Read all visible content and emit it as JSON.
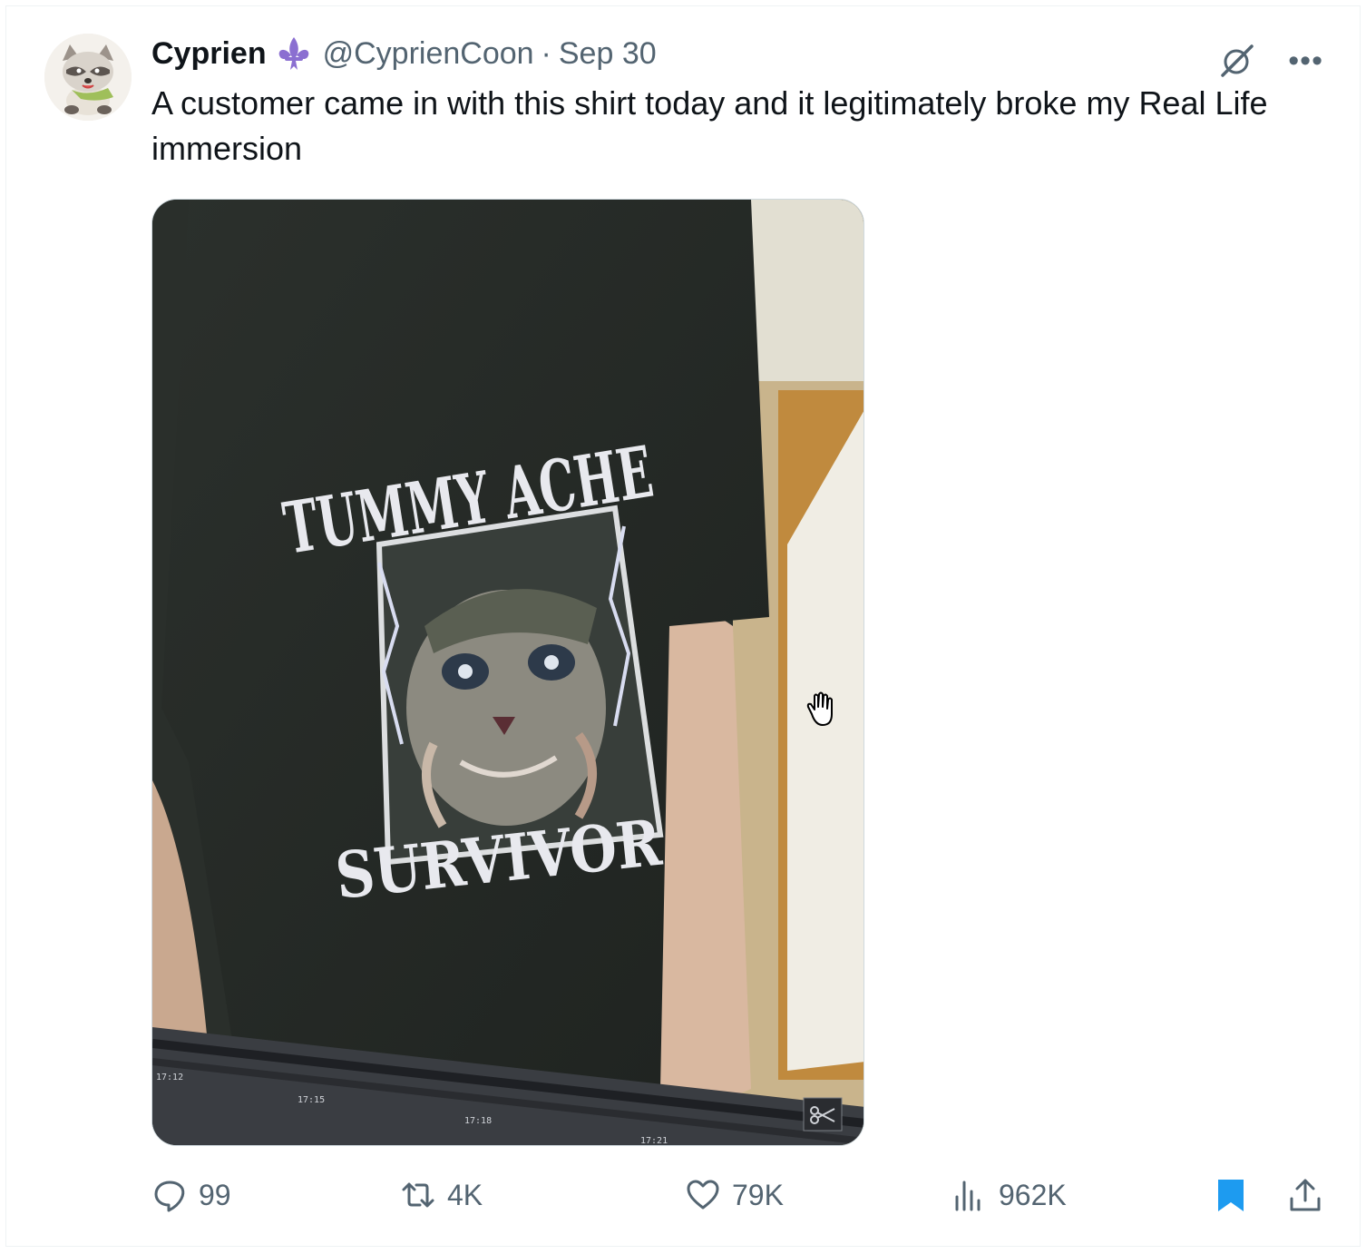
{
  "author": {
    "name": "Cyprien",
    "handle": "@CyprienCoon",
    "separator": "·",
    "date": "Sep 30",
    "avatar_icon": "raccoon-avatar-icon",
    "badge_icon": "fleur-de-lis-icon"
  },
  "tweet": {
    "text": "A customer came in with this shirt today and it legitimately broke my Real Life immersion"
  },
  "media": {
    "shirt_line1": "TUMMY ACHE",
    "shirt_line2": "SURVIVOR",
    "timeline_labels": [
      "17:12",
      "17:15",
      "17:18",
      "17:21"
    ]
  },
  "actions": {
    "replies": "99",
    "reposts": "4K",
    "likes": "79K",
    "views": "962K"
  },
  "colors": {
    "text_primary": "#0f1419",
    "text_secondary": "#536471",
    "bookmark_active": "#1d9bf0",
    "badge": "#8b6fd1"
  }
}
